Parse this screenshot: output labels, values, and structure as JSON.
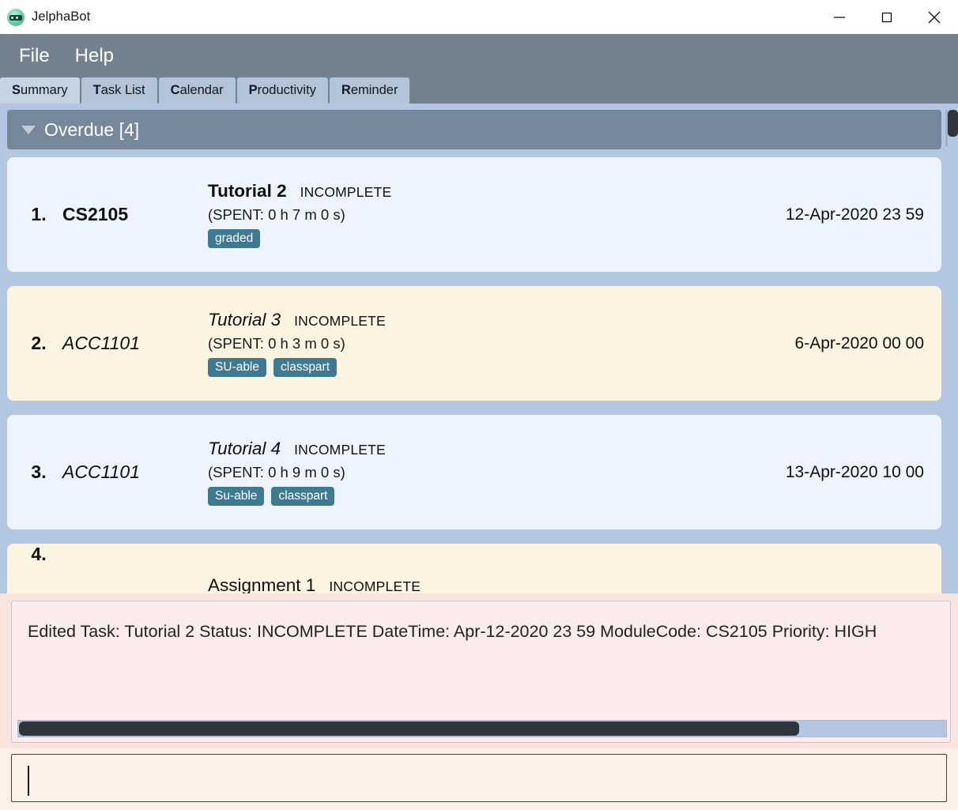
{
  "window": {
    "title": "JelphaBot",
    "icon": "robot-icon",
    "controls": {
      "minimize": "minimize-icon",
      "maximize": "maximize-icon",
      "close": "close-icon"
    }
  },
  "menubar": {
    "items": [
      {
        "label": "File"
      },
      {
        "label": "Help"
      }
    ]
  },
  "tabs": [
    {
      "mnemonic": "S",
      "rest": "ummary",
      "active": true
    },
    {
      "mnemonic": "T",
      "rest": "ask List",
      "active": false
    },
    {
      "mnemonic": "C",
      "rest": "alendar",
      "active": false
    },
    {
      "mnemonic": "P",
      "rest": "roductivity",
      "active": false
    },
    {
      "mnemonic": "R",
      "rest": "eminder",
      "active": false
    }
  ],
  "section": {
    "caret": "chevron-down-icon",
    "title": "Overdue [4]"
  },
  "tasks": [
    {
      "index": "1.",
      "module": "CS2105",
      "name": "Tutorial 2",
      "status": "INCOMPLETE",
      "spent": "(SPENT: 0 h 7 m 0 s)",
      "tags": [
        "graded"
      ],
      "date": "12-Apr-2020 23 59",
      "style": "blue",
      "emphasis": "bold"
    },
    {
      "index": "2.",
      "module": "ACC1101",
      "name": "Tutorial 3",
      "status": "INCOMPLETE",
      "spent": "(SPENT: 0 h 3 m 0 s)",
      "tags": [
        "SU-able",
        "classpart"
      ],
      "date": "6-Apr-2020 00 00",
      "style": "cream",
      "emphasis": "italic"
    },
    {
      "index": "3.",
      "module": "ACC1101",
      "name": "Tutorial 4",
      "status": "INCOMPLETE",
      "spent": "(SPENT: 0 h 9 m 0 s)",
      "tags": [
        "Su-able",
        "classpart"
      ],
      "date": "13-Apr-2020 10 00",
      "style": "blue",
      "emphasis": "italic"
    },
    {
      "index": "4.",
      "module": "",
      "name": "Assignment 1",
      "status": "INCOMPLETE",
      "spent": "",
      "tags": [],
      "date": "",
      "style": "cream",
      "emphasis": "normal"
    }
  ],
  "result": {
    "text": "Edited Task: Tutorial 2 Status: INCOMPLETE DateTime: Apr-12-2020 23 59 ModuleCode: CS2105 Priority: HIGH"
  },
  "command": {
    "value": "",
    "placeholder": ""
  },
  "colors": {
    "menubar": "#74828f",
    "tab_active": "#c5d3e3",
    "tab_inactive": "#b3c4d8",
    "list_background": "#b3c7e2",
    "section_header": "#77889c",
    "card_blue": "#edf4fd",
    "card_cream": "#fdf3e1",
    "tag": "#3f7a93",
    "result_background": "#fcebec",
    "result_outer": "#fbe4dd",
    "command_background": "#fdf1ea"
  }
}
